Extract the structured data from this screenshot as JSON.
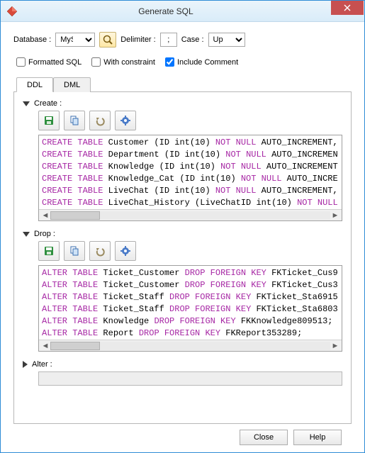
{
  "window": {
    "title": "Generate SQL"
  },
  "toolbar_row": {
    "database_label": "Database :",
    "database_value": "MySQL",
    "delimiter_label": "Delimiter :",
    "delimiter_value": ";",
    "case_label": "Case :",
    "case_value": "Upper"
  },
  "options": {
    "formatted_sql": {
      "label": "Formatted SQL",
      "checked": false
    },
    "with_constraint": {
      "label": "With constraint",
      "checked": false
    },
    "include_comment": {
      "label": "Include Comment",
      "checked": true
    }
  },
  "tabs": [
    {
      "id": "ddl",
      "label": "DDL",
      "active": true
    },
    {
      "id": "dml",
      "label": "DML",
      "active": false
    }
  ],
  "create": {
    "label": "Create :",
    "lines": [
      {
        "kw1": "CREATE TABLE",
        "name": "Customer",
        "paren": "(ID int(10)",
        "kw2": "NOT NULL",
        "tail": "AUTO_INCREMENT,"
      },
      {
        "kw1": "CREATE TABLE",
        "name": "Department",
        "paren": "(ID int(10)",
        "kw2": "NOT NULL",
        "tail": "AUTO_INCREMEN"
      },
      {
        "kw1": "CREATE TABLE",
        "name": "Knowledge",
        "paren": "(ID int(10)",
        "kw2": "NOT NULL",
        "tail": "AUTO_INCREMENT"
      },
      {
        "kw1": "CREATE TABLE",
        "name": "Knowledge_Cat",
        "paren": "(ID int(10)",
        "kw2": "NOT NULL",
        "tail": "AUTO_INCRE"
      },
      {
        "kw1": "CREATE TABLE",
        "name": "LiveChat",
        "paren": "(ID int(10)",
        "kw2": "NOT NULL",
        "tail": "AUTO_INCREMENT,"
      },
      {
        "kw1": "CREATE TABLE",
        "name": "LiveChat_History",
        "paren": "(LiveChatID int(10)",
        "kw2": "NOT NULL",
        "tail": ""
      }
    ]
  },
  "drop": {
    "label": "Drop :",
    "lines": [
      {
        "kw1": "ALTER TABLE",
        "name": "Ticket_Customer",
        "kw2": "DROP FOREIGN KEY",
        "tail": "FKTicket_Cus9"
      },
      {
        "kw1": "ALTER TABLE",
        "name": "Ticket_Customer",
        "kw2": "DROP FOREIGN KEY",
        "tail": "FKTicket_Cus3"
      },
      {
        "kw1": "ALTER TABLE",
        "name": "Ticket_Staff",
        "kw2": "DROP FOREIGN KEY",
        "tail": "FKTicket_Sta6915"
      },
      {
        "kw1": "ALTER TABLE",
        "name": "Ticket_Staff",
        "kw2": "DROP FOREIGN KEY",
        "tail": "FKTicket_Sta6803"
      },
      {
        "kw1": "ALTER TABLE",
        "name": "Knowledge",
        "kw2": "DROP FOREIGN KEY",
        "tail": "FKKnowledge809513;"
      },
      {
        "kw1": "ALTER TABLE",
        "name": "Report",
        "kw2": "DROP FOREIGN KEY",
        "tail": "FKReport353289;"
      }
    ]
  },
  "alter": {
    "label": "Alter :"
  },
  "footer": {
    "close": "Close",
    "help": "Help"
  },
  "icons": {
    "save": "save-icon",
    "copy": "copy-icon",
    "undo": "undo-icon",
    "gear": "gear-icon",
    "magnify": "magnify-icon"
  }
}
